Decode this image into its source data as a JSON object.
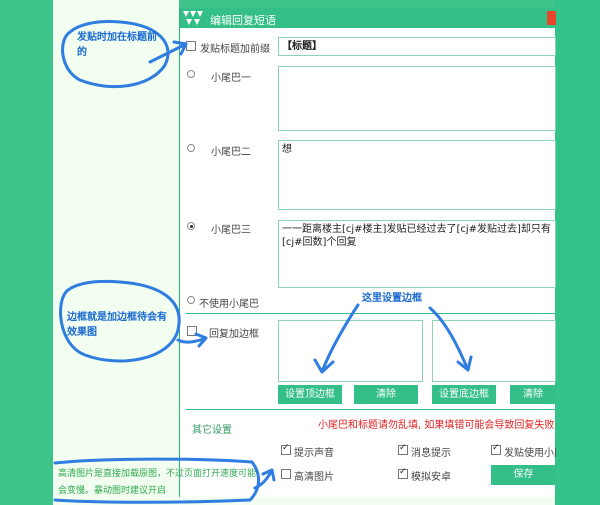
{
  "dialog": {
    "title": "编辑回复短语",
    "title_prefix": {
      "label": "发贴标题加前缀",
      "checked": false,
      "value": "【标题】"
    },
    "tails": [
      {
        "label": "小尾巴一",
        "selected": false,
        "value": ""
      },
      {
        "label": "小尾巴二",
        "selected": false,
        "value": "想"
      },
      {
        "label": "小尾巴三",
        "selected": true,
        "value": "一一距离楼主[cj#楼主]发贴已经过去了[cj#发贴过去]却只有[cj#回数]个回复"
      }
    ],
    "no_tail_label": "不使用小尾巴",
    "border": {
      "label": "回复加边框",
      "checked": false,
      "set_top_label": "设置顶边框",
      "clear_label_1": "清除",
      "set_bottom_label": "设置底边框",
      "clear_label_2": "清除"
    },
    "other": {
      "section_label": "其它设置",
      "warning": "小尾巴和标题请勿乱填, 如果填错可能会导致回复失败",
      "options": [
        {
          "label": "提示声音",
          "checked": true
        },
        {
          "label": "消息提示",
          "checked": true
        },
        {
          "label": "发贴使用小尾",
          "checked": true
        },
        {
          "label": "高清图片",
          "checked": false
        },
        {
          "label": "模拟安卓",
          "checked": true
        }
      ],
      "save_label": "保存"
    }
  },
  "annotations": {
    "note1": "发贴时加在标题前的",
    "note2": "这里设置边框",
    "note3": "边框就是加边框待会有效果图",
    "note4": "高清图片是直接加载原图，不过页面打开速度可能会变慢。暴动图时建议开启"
  },
  "colors": {
    "accent": "#33bf87",
    "warning": "#e02020",
    "annotation": "#1a6ad1"
  }
}
